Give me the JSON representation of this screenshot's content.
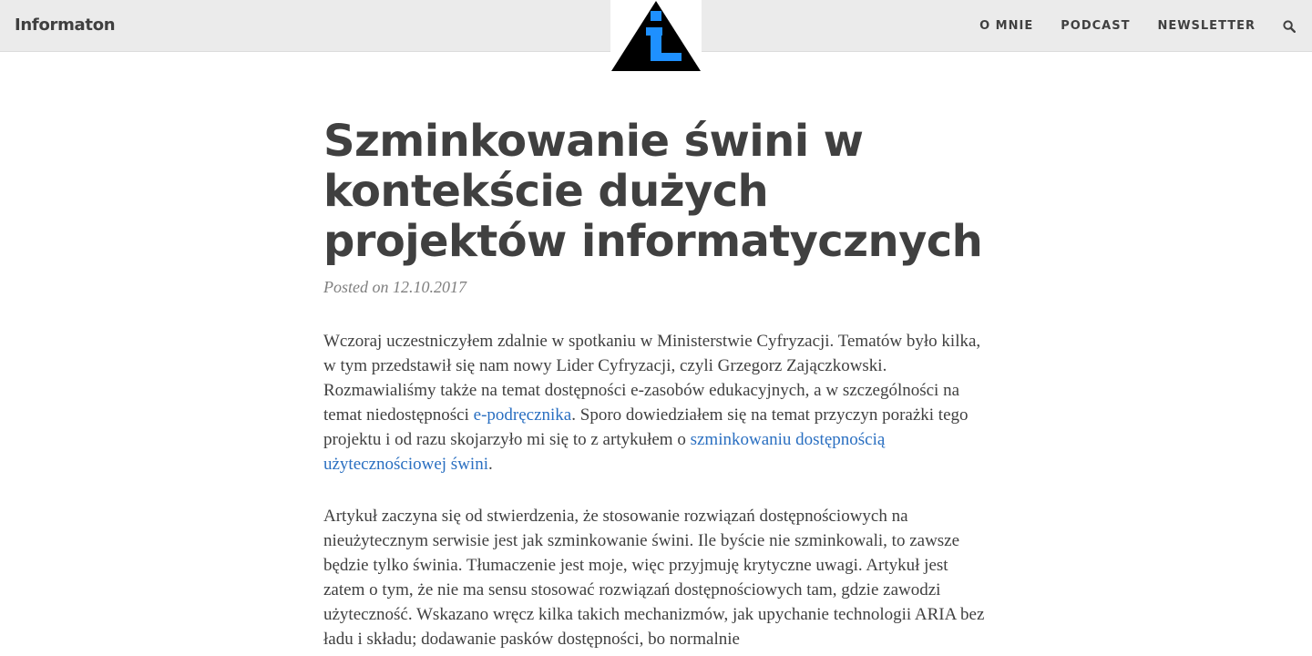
{
  "navbar": {
    "brand": "Informaton",
    "links": [
      "O MNIE",
      "PODCAST",
      "NEWSLETTER"
    ],
    "search_icon": "search-icon",
    "logo_icon": "info-triangle-logo-icon",
    "logo_colors": {
      "triangle": "#000000",
      "glyph": "#1e90ff"
    }
  },
  "post": {
    "title": "Szminkowanie świni w kontekście dużych projektów informatycznych",
    "meta": "Posted on 12.10.2017",
    "p1": {
      "part1": "Wczoraj uczestniczyłem zdalnie w spotkaniu w Ministerstwie Cyfryzacji. Tematów było kilka, w tym przedstawił się nam nowy Lider Cyfryzacji, czyli Grzegorz Zajączkowski. Rozmawialiśmy także na temat dostępności e-zasobów edukacyjnych, a w szczególności na temat niedostępności ",
      "link1": "e-podręcznika",
      "part2": ". Sporo dowiedziałem się na temat przyczyn porażki tego projektu i od razu skojarzyło mi się to z artykułem o ",
      "link2": "szminkowaniu dostępnością użytecznościowej świni",
      "part3": "."
    },
    "p2": "Artykuł zaczyna się od stwierdzenia, że stosowanie rozwiązań dostępnościowych na nieużytecznym serwisie jest jak szminkowanie świni. Ile byście nie szminkowali, to zawsze będzie tylko świnia. Tłumaczenie jest moje, więc przyjmuję krytyczne uwagi. Artykuł jest zatem o tym, że nie ma sensu stosować rozwiązań dostępnościowych tam, gdzie zawodzi użyteczność. Wskazano wręcz kilka takich mechanizmów, jak upychanie technologii ARIA bez ładu i składu; dodawanie pasków dostępności, bo normalnie"
  }
}
